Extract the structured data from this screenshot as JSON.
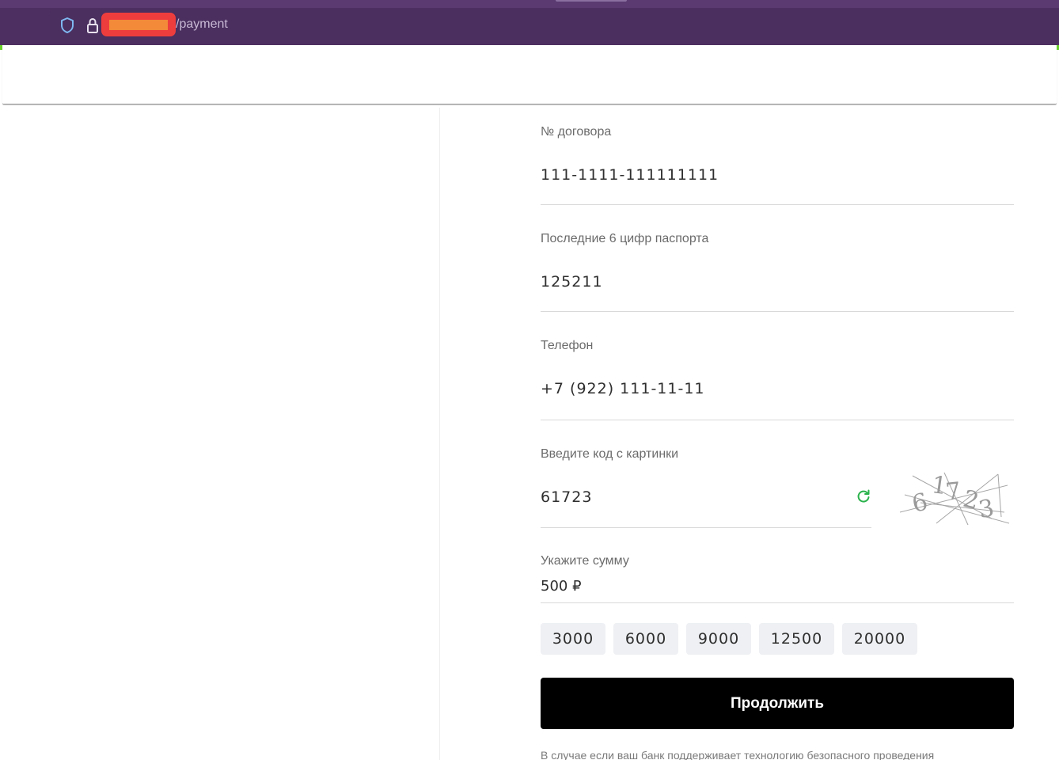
{
  "browser": {
    "url_path": "/payment"
  },
  "form": {
    "contract": {
      "label": "№ договора",
      "value": "111-1111-111111111"
    },
    "passport": {
      "label": "Последние 6 цифр паспорта",
      "value": "125211"
    },
    "phone": {
      "label": "Телефон",
      "value": "+7 (922) 111-11-11"
    },
    "captcha": {
      "label": "Введите код с картинки",
      "value": "61723",
      "image_text": "61723"
    },
    "amount": {
      "label": "Укажите сумму",
      "value": "500 ₽"
    },
    "quick_amounts": [
      "3000",
      "6000",
      "9000",
      "12500",
      "20000"
    ],
    "continue_label": "Продолжить",
    "footnote": "В случае если ваш банк поддерживает технологию безопасного проведения"
  },
  "colors": {
    "browser_bg": "#4e2f61",
    "accent_green": "#2bb24c",
    "button_bg": "#000000",
    "chip_bg": "#eef0f3"
  },
  "icons": [
    "shield-icon",
    "lock-icon",
    "refresh-icon"
  ]
}
